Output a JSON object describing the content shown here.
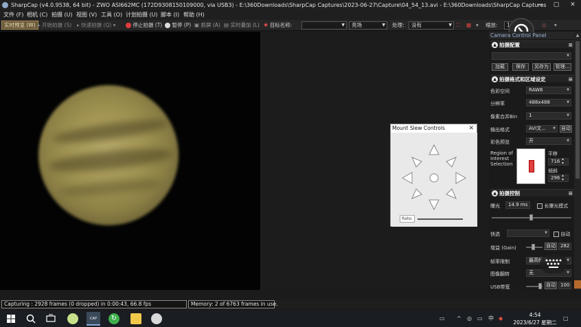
{
  "window": {
    "title": "SharpCap (v4.0.9538, 64 bit) - ZWO ASI662MC (172D9308150109000, via USB3) - E:\\360Downloads\\SharpCap Captures\\2023-06-27\\Capture\\04_54_13.avi - E:\\360Downloads\\SharpCap Captures",
    "minimize": "—",
    "maximize": "▢",
    "close": "✕"
  },
  "menu": {
    "items": [
      "文件 (F)",
      "相机 (C)",
      "拍摄 (U)",
      "视图 (V)",
      "工具 (O)",
      "计划拍摄 (U)",
      "脚本 (I)",
      "帮助 (H)"
    ]
  },
  "toolbar": {
    "live_view": "实时预览 (W)",
    "start_capture": "开始拍摄 (S)",
    "quick_capture": "快速拍摄 (Q)",
    "stop_capture": "停止拍摄 (T)",
    "pause": "暂停 (P)",
    "snapshot": "抓屏 (A)",
    "live_stack": "实时叠加 (L)",
    "target_label": "目标名称:",
    "target_value": "",
    "target2_value": "亮场",
    "processing_label": "处理:",
    "processing_value": "没有",
    "zoom_label": "缩放:",
    "zoom_value": "1"
  },
  "slew_dialog": {
    "title": "Mount Slew Controls",
    "close": "✕",
    "rate_label": "Rate:"
  },
  "panel": {
    "title": "Camera Control Panel",
    "sec1": {
      "title": "拍摄配置",
      "buttons": [
        "加载",
        "保存",
        "另存为",
        "管理..."
      ]
    },
    "sec2": {
      "title": "拍摄格式和区域设定",
      "rows": [
        {
          "label": "色彩空间",
          "value": "RAW8"
        },
        {
          "label": "分辨率",
          "value": "488x488"
        },
        {
          "label": "像素合并Bin",
          "value": "1"
        },
        {
          "label": "输出格式",
          "value": "AVI文..."
        },
        {
          "label": "彩色预览",
          "value": "开"
        }
      ],
      "auto": "自动",
      "roi_label": "Region of Interest Selection",
      "pan_label": "平移",
      "pan_value": "716",
      "tilt_label": "倾斜",
      "tilt_value": "296"
    },
    "sec3": {
      "title": "拍摄控制",
      "exposure_label": "曝光",
      "exposure_value": "14.9 ms",
      "long_exposure": "长曝光模式",
      "quick_label": "快选",
      "auto": "自动",
      "gain_label": "增益 (Gain)",
      "gain_auto": "自动",
      "gain_value": "282",
      "fps_label": "帧率限制",
      "fps_value": "最高帧率",
      "flip_label": "图像翻转",
      "flip_value": "无",
      "usb_label": "USB带宽",
      "usb_auto": "自动",
      "usb_value": "100"
    }
  },
  "status": {
    "capturing": "Capturing : 2928 frames (0 dropped) in 0:00:43, 66.8 fps",
    "memory": "Memory: 2 of 6763 frames in use."
  },
  "taskbar": {
    "time": "4:54",
    "date": "2023/6/27 星期二",
    "ime": "中"
  }
}
